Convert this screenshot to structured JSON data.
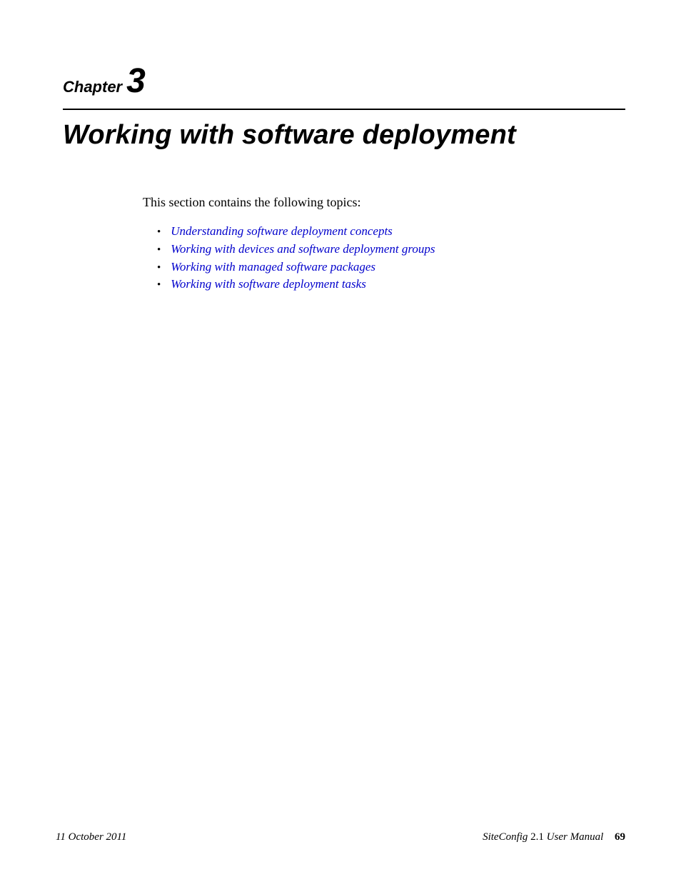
{
  "chapter": {
    "label": "Chapter",
    "number": "3"
  },
  "title": "Working with software deployment",
  "intro": "This section contains the following topics:",
  "toc": [
    "Understanding software deployment concepts",
    "Working with devices and software deployment groups",
    "Working with managed software packages",
    "Working with software deployment tasks"
  ],
  "footer": {
    "date": "11 October 2011",
    "product": "SiteConfig",
    "version": "2.1",
    "manual": "User Manual",
    "page": "69"
  }
}
